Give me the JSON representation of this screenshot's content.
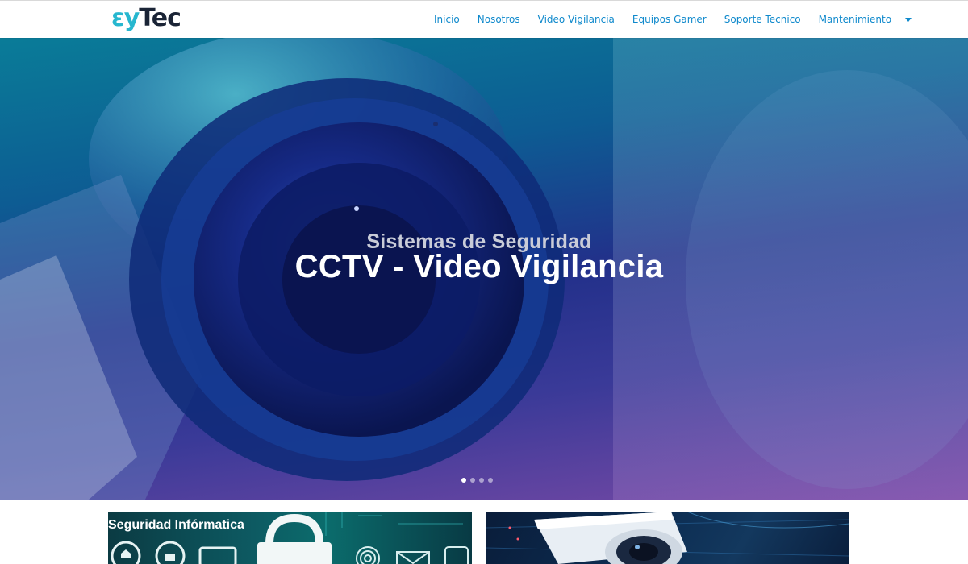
{
  "brand": {
    "logo_part1": "ɛy",
    "logo_part2": "Tec"
  },
  "nav": {
    "items": [
      "Inicio",
      "Nosotros",
      "Video Vigilancia",
      "Equipos Gamer",
      "Soporte Tecnico",
      "Mantenimiento"
    ],
    "has_dropdown": true
  },
  "hero": {
    "subtitle": "Sistemas de Seguridad",
    "title": "CCTV - Video Vigilancia",
    "slide_count": 4,
    "active_slide": 1
  },
  "cards": [
    {
      "title": "Seguridad Infórmatica"
    },
    {
      "title": ""
    }
  ],
  "colors": {
    "nav_link": "#0f89cc",
    "logo_accent": "#27b7cf",
    "logo_dark": "#1a2436",
    "hero_gradient_top": "#0a7c98",
    "hero_gradient_bottom": "#7a4aa6"
  },
  "icons": [
    "chevron-down-icon",
    "cctv-camera-image",
    "padlock-icon",
    "fingerprint-icon",
    "envelope-icon",
    "cloud-lock-icon",
    "shield-icon"
  ]
}
